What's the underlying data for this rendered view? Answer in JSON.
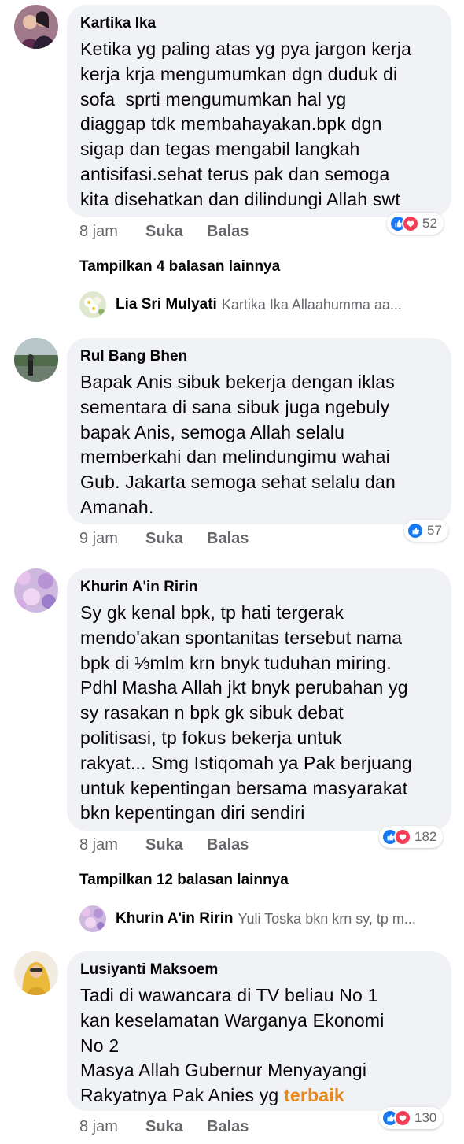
{
  "comments": [
    {
      "author": "Kartika Ika",
      "text": "Ketika yg paling atas yg pya jargon kerja\nkerja krja mengumumkan dgn duduk di\nsofa  sprti mengumumkan hal yg\ndiaggap tdk membahayakan.bpk dgn\nsigap dan tegas mengabil langkah\nantisifasi.sehat terus pak dan semoga\nkita disehatkan dan dilindungi Allah swt",
      "time": "8 jam",
      "like_label": "Suka",
      "reply_label": "Balas",
      "reaction_count": "52",
      "reactions": [
        "like-icon",
        "love-icon"
      ],
      "more_replies": "Tampilkan 4 balasan lainnya",
      "reply_preview": {
        "name": "Lia Sri Mulyati",
        "text": "Kartika Ika Allaahumma aa..."
      }
    },
    {
      "author": "Rul Bang Bhen",
      "text": "Bapak Anis sibuk bekerja dengan iklas\nsementara di sana sibuk juga ngebuly\nbapak Anis, semoga Allah selalu\nmemberkahi dan melindungimu wahai\nGub. Jakarta semoga sehat selalu dan\nAmanah.",
      "time": "9 jam",
      "like_label": "Suka",
      "reply_label": "Balas",
      "reaction_count": "57",
      "reactions": [
        "like-icon"
      ]
    },
    {
      "author": "Khurin A'in Ririn",
      "text": "Sy gk kenal bpk, tp hati tergerak\nmendo'akan spontanitas tersebut nama\nbpk di ⅓mlm krn bnyk tuduhan miring.\nPdhl Masha Allah jkt bnyk perubahan yg\nsy rasakan n bpk gk sibuk debat\npolitisasi, tp fokus bekerja untuk\nrakyat... Smg Istiqomah ya Pak berjuang\nuntuk kepentingan bersama masyarakat\nbkn kepentingan diri sendiri",
      "time": "8 jam",
      "like_label": "Suka",
      "reply_label": "Balas",
      "reaction_count": "182",
      "reactions": [
        "like-icon",
        "love-icon"
      ],
      "more_replies": "Tampilkan 12 balasan lainnya",
      "reply_preview": {
        "name": "Khurin A'in Ririn",
        "text": "Yuli Toska bkn krn sy, tp m..."
      }
    },
    {
      "author": "Lusiyanti Maksoem",
      "text_main": "Tadi di wawancara di TV beliau No 1\nkan keselamatan Warganya Ekonomi\nNo 2\nMasya Allah Gubernur Menyayangi\nRakyatnya Pak Anies yg ",
      "text_highlight": "terbaik",
      "time": "8 jam",
      "like_label": "Suka",
      "reply_label": "Balas",
      "reaction_count": "130",
      "reactions": [
        "like-icon",
        "love-icon"
      ]
    }
  ],
  "colors": {
    "bubble": "#f0f2f5",
    "like": "#1877f2",
    "love": "#f33e58",
    "meta": "#65676b",
    "highlight": "#e48a1a"
  }
}
